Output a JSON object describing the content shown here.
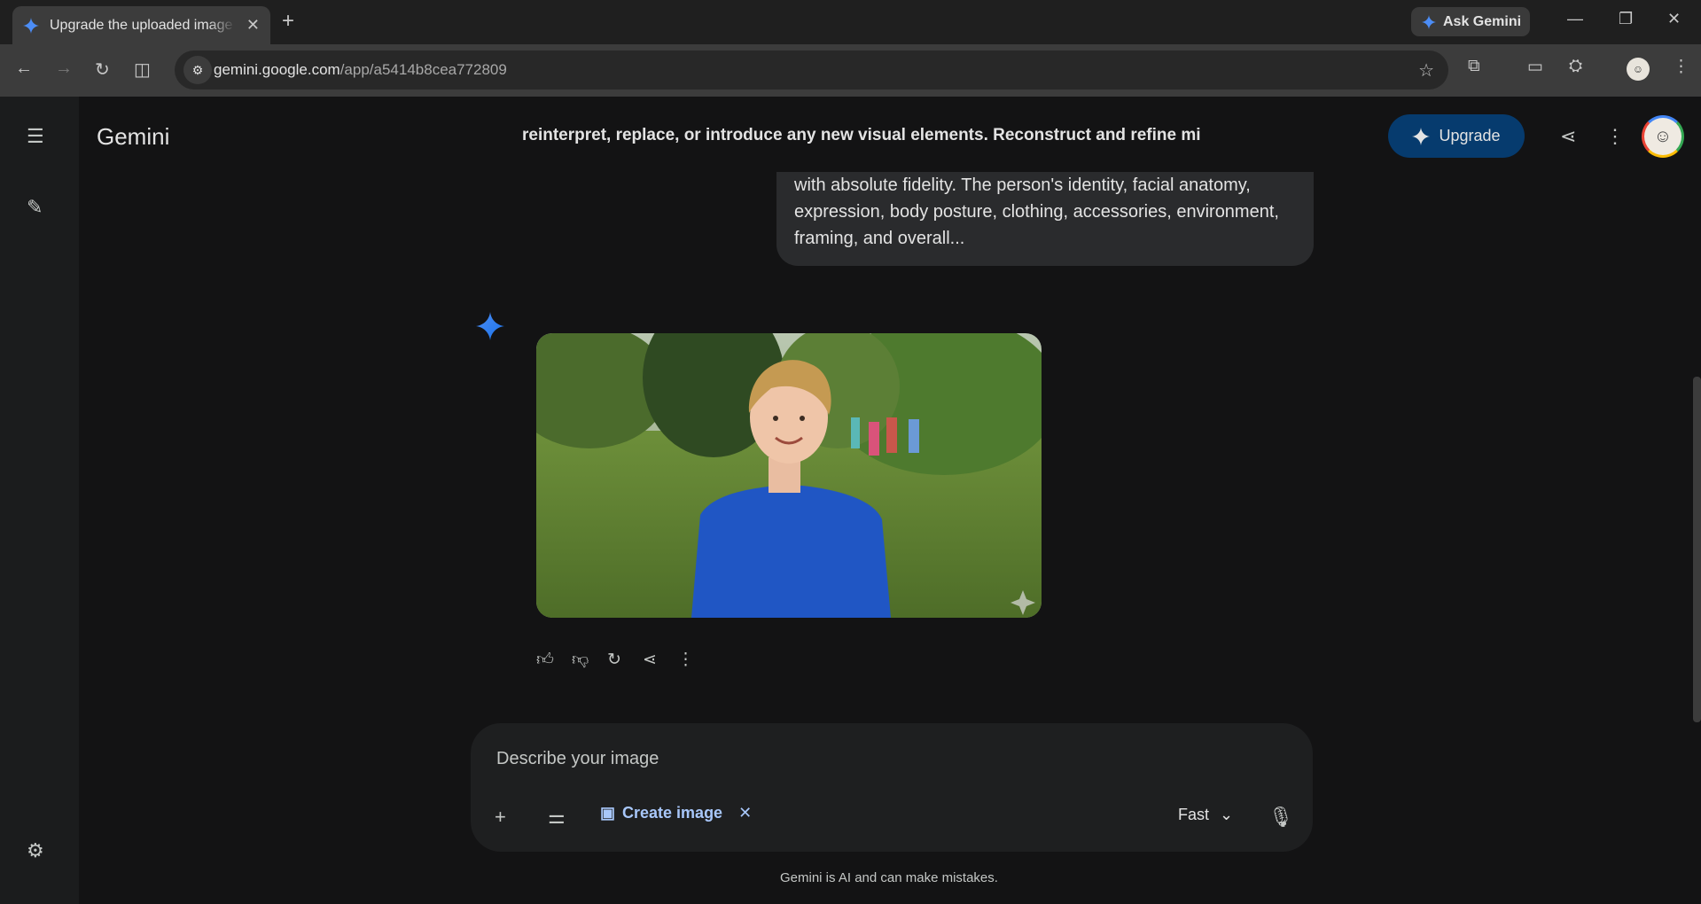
{
  "browser": {
    "tab_title": "Upgrade the uploaded image in",
    "tab_close": "✕",
    "new_tab": "+",
    "ask_gemini": "Ask Gemini",
    "url_host": "gemini.google.com",
    "url_path": "/app/a5414b8cea772809"
  },
  "header": {
    "brand": "Gemini",
    "chat_title": "reinterpret, replace, or introduce any new visual elements. Reconstruct and refine mi",
    "upgrade_label": "Upgrade"
  },
  "conversation": {
    "user_message": "with absolute fidelity. The person's identity, facial anatomy, expression, body posture, clothing, accessories, environment, framing, and overall...",
    "accent_color": "#4285f4"
  },
  "composer": {
    "placeholder": "Describe your image",
    "create_image_label": "Create image",
    "model_label": "Fast"
  },
  "footer": {
    "disclaimer": "Gemini is AI and can make mistakes."
  }
}
